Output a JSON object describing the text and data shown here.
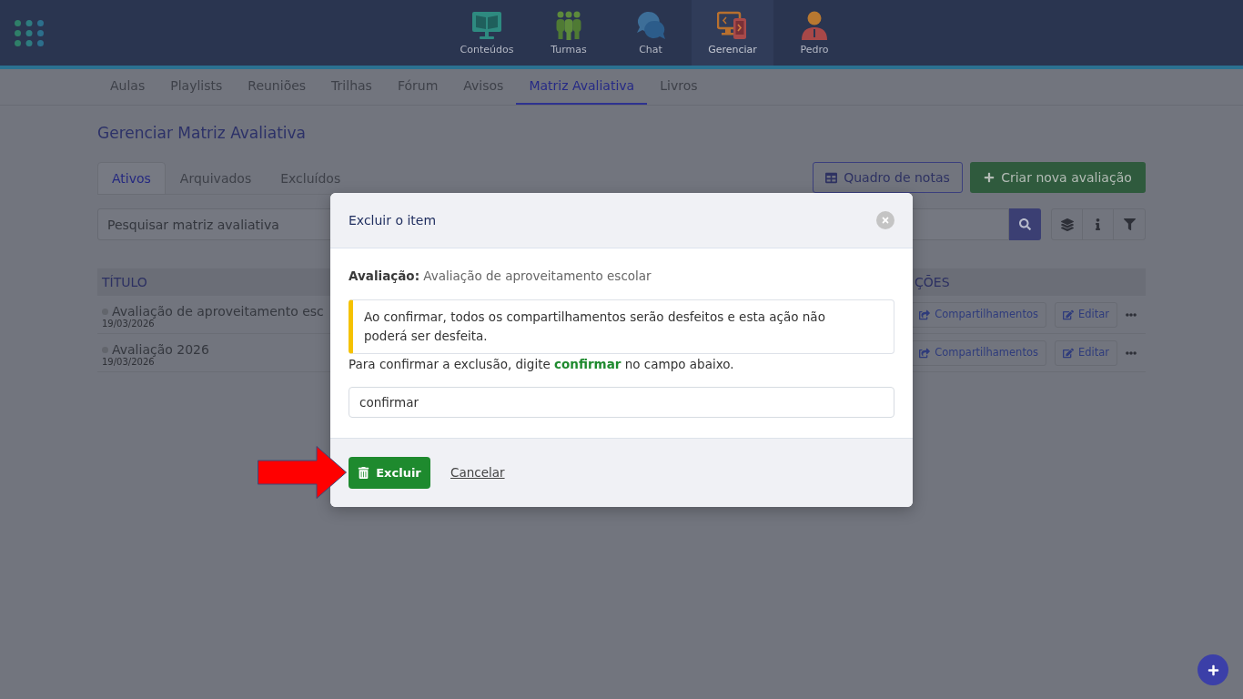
{
  "app_bar": {
    "items": [
      {
        "label": "Conteúdos",
        "selected": false
      },
      {
        "label": "Turmas",
        "selected": false
      },
      {
        "label": "Chat",
        "selected": false
      },
      {
        "label": "Gerenciar",
        "selected": true
      },
      {
        "label": "Pedro",
        "selected": false
      }
    ]
  },
  "section_tabs": [
    {
      "label": "Aulas",
      "selected": false
    },
    {
      "label": "Playlists",
      "selected": false
    },
    {
      "label": "Reuniões",
      "selected": false
    },
    {
      "label": "Trilhas",
      "selected": false
    },
    {
      "label": "Fórum",
      "selected": false
    },
    {
      "label": "Avisos",
      "selected": false
    },
    {
      "label": "Matriz Avaliativa",
      "selected": true
    },
    {
      "label": "Livros",
      "selected": false
    }
  ],
  "page": {
    "title": "Gerenciar Matriz Avaliativa",
    "tabs": [
      {
        "label": "Ativos",
        "selected": true
      },
      {
        "label": "Arquivados",
        "selected": false
      },
      {
        "label": "Excluídos",
        "selected": false
      }
    ],
    "grades_button": "Quadro de notas",
    "create_button": "Criar nova avaliação",
    "search": {
      "placeholder": "Pesquisar matriz avaliativa"
    },
    "table": {
      "columns": [
        "TÍTULO",
        "ÇÕES"
      ],
      "rows": [
        {
          "title": "Avaliação de aproveitamento esc",
          "date": "19/03/2026",
          "actions": [
            "Compartilhamentos",
            "Editar"
          ]
        },
        {
          "title": "Avaliação 2026",
          "date": "19/03/2026",
          "actions": [
            "Compartilhamentos",
            "Editar"
          ]
        }
      ]
    }
  },
  "dialog": {
    "title": "Excluir o item",
    "subject": "**Avaliação:** Avaliação de aproveitamento escolar",
    "warning": "Ao confirmar, todos os compartilhamentos serão desfeitos e esta ação não poderá ser desfeita.",
    "instruction": "Para confirmar a exclusão, digite **confirmar** no campo abaixo.",
    "input": {
      "value": "confirmar"
    },
    "delete_button": "Excluir",
    "cancel_link": "Cancelar"
  }
}
